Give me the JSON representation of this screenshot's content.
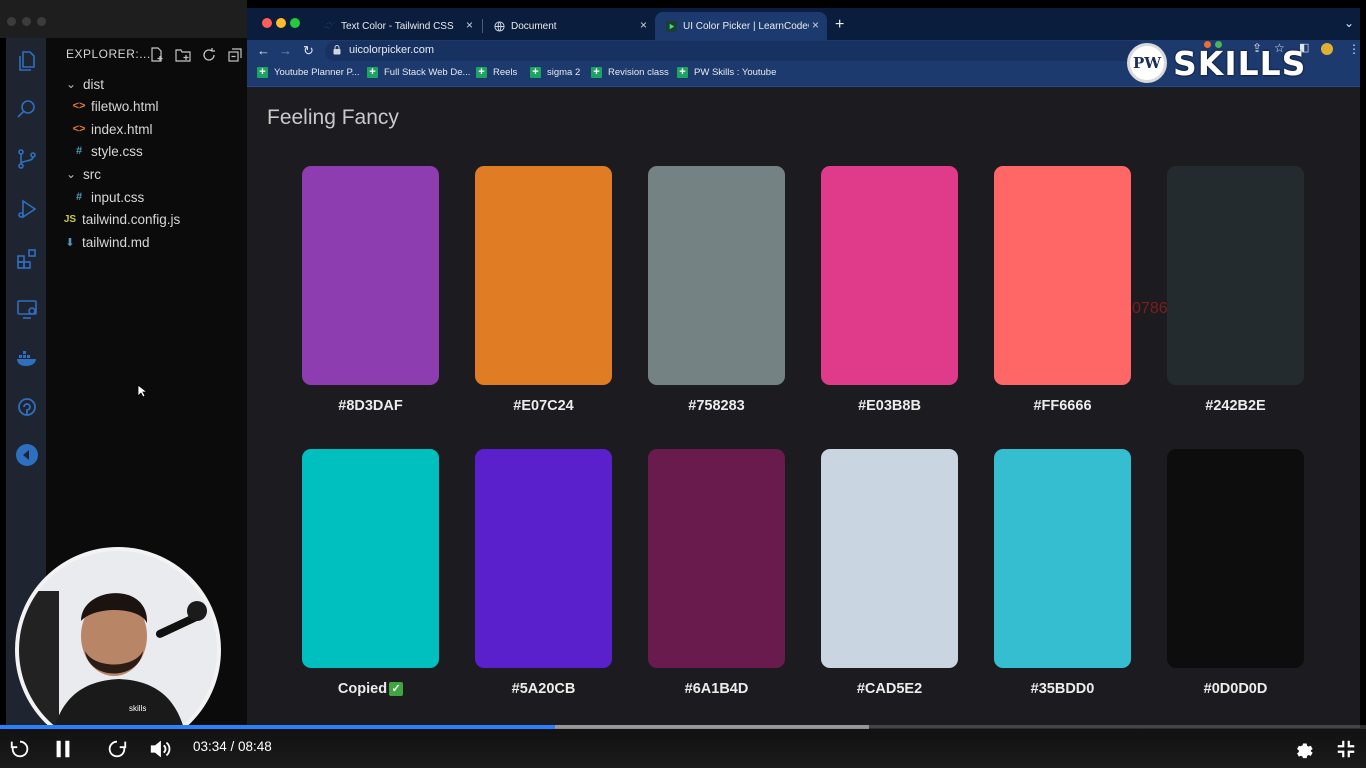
{
  "explorer": {
    "header": "EXPLORER:...",
    "tree": [
      {
        "label": "dist",
        "icon": "chevron-down-icon"
      },
      {
        "label": "filetwo.html",
        "icon": "html-file-icon"
      },
      {
        "label": "index.html",
        "icon": "html-file-icon"
      },
      {
        "label": "style.css",
        "icon": "css-file-icon"
      },
      {
        "label": "src",
        "icon": "chevron-down-icon"
      },
      {
        "label": "input.css",
        "icon": "css-file-icon"
      },
      {
        "label": "tailwind.config.js",
        "icon": "js-file-icon"
      },
      {
        "label": "tailwind.md",
        "icon": "markdown-file-icon"
      }
    ]
  },
  "browser": {
    "tabs": [
      {
        "title": "Text Color - Tailwind CSS",
        "close": "×"
      },
      {
        "title": "Document",
        "close": "×"
      },
      {
        "title": "UI Color Picker | LearnCodeOnl",
        "close": "×"
      }
    ],
    "new_tab": "+",
    "url": "uicolorpicker.com",
    "bookmarks": [
      "Youtube Planner P...",
      "Full Stack Web De...",
      "Reels",
      "sigma 2",
      "Revision class",
      "PW Skills : Youtube"
    ]
  },
  "logo": {
    "mark": "PW",
    "text": "SKILLS"
  },
  "page": {
    "title": "Feeling Fancy",
    "watermark": "missgulnaz0786@gmail.com",
    "swatches": [
      {
        "label": "#8D3DAF",
        "color": "#8D3DAF"
      },
      {
        "label": "#E07C24",
        "color": "#E07C24"
      },
      {
        "label": "#758283",
        "color": "#758283"
      },
      {
        "label": "#E03B8B",
        "color": "#E03B8B"
      },
      {
        "label": "#FF6666",
        "color": "#FF6666"
      },
      {
        "label": "#242B2E",
        "color": "#242B2E"
      },
      {
        "label": "Copied",
        "color": "#00BFBF",
        "check": "✓"
      },
      {
        "label": "#5A20CB",
        "color": "#5A20CB"
      },
      {
        "label": "#6A1B4D",
        "color": "#6A1B4D"
      },
      {
        "label": "#CAD5E2",
        "color": "#CAD5E2"
      },
      {
        "label": "#35BDD0",
        "color": "#35BDD0"
      },
      {
        "label": "#0D0D0D",
        "color": "#0D0D0D"
      }
    ]
  },
  "player": {
    "time": "03:34 / 08:48",
    "progress_fraction": 0.406,
    "buffered_fraction": 0.636
  }
}
